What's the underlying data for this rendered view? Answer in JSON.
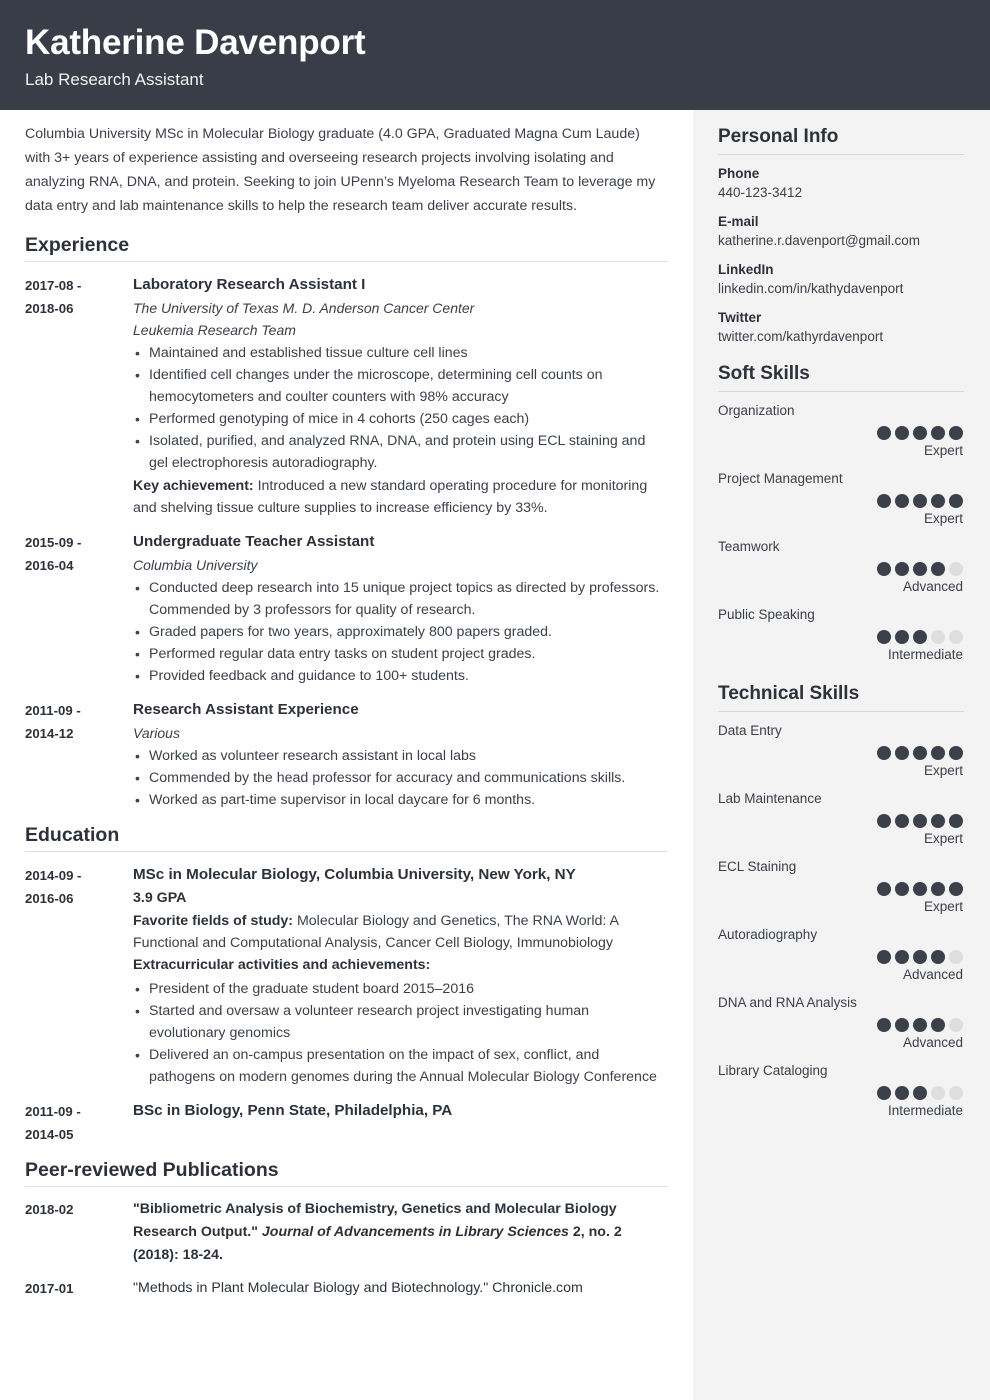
{
  "header": {
    "name": "Katherine Davenport",
    "role": "Lab Research Assistant",
    "bg_color": "#383d47"
  },
  "summary": "Columbia University MSc in Molecular Biology graduate (4.0 GPA, Graduated Magna Cum Laude) with 3+ years of experience assisting and overseeing research projects involving isolating and analyzing RNA, DNA, and protein. Seeking to join UPenn’s Myeloma Research Team to leverage my data entry and lab maintenance skills to help the research team deliver accurate results.",
  "sections": {
    "experience_title": "Experience",
    "education_title": "Education",
    "publications_title": "Peer-reviewed Publications"
  },
  "experience": [
    {
      "date": "2017-08 -\n2018-06",
      "date_start": "2017-08 -",
      "date_end": "2018-06",
      "title": "Laboratory Research Assistant I",
      "org": "The University of Texas M. D. Anderson Cancer Center",
      "team": "Leukemia Research Team",
      "bullets": [
        "Maintained and established tissue culture cell lines",
        "Identified cell changes under the microscope, determining cell counts on hemocytometers and coulter counters with 98% accuracy",
        "Performed genotyping of mice in 4 cohorts (250 cages each)",
        "Isolated, purified, and analyzed RNA, DNA, and protein using ECL staining and gel electrophoresis autoradiography."
      ],
      "key_achievement_label": "Key achievement:",
      "key_achievement_text": " Introduced a new standard operating procedure for monitoring and shelving tissue culture supplies to increase efficiency by 33%."
    },
    {
      "date_start": "2015-09 -",
      "date_end": "2016-04",
      "title": "Undergraduate Teacher Assistant",
      "org": "Columbia University",
      "team": "",
      "bullets": [
        "Conducted deep research into 15 unique project topics as directed by professors. Commended by 3 professors for quality of research.",
        "Graded papers for two years, approximately 800 papers graded.",
        "Performed regular data entry tasks on student project grades.",
        "Provided feedback and guidance to 100+ students."
      ]
    },
    {
      "date_start": "2011-09 -",
      "date_end": "2014-12",
      "title": "Research Assistant Experience",
      "org": "Various",
      "team": "",
      "bullets": [
        "Worked as volunteer research assistant in local labs",
        "Commended by the head professor for accuracy and communications skills.",
        "Worked as part-time supervisor in local daycare for 6 months."
      ]
    }
  ],
  "education": [
    {
      "date_start": "2014-09 -",
      "date_end": "2016-06",
      "title": "MSc in Molecular Biology, Columbia University, New York, NY",
      "gpa": "3.9 GPA",
      "fields_label": "Favorite fields of study:",
      "fields_text": " Molecular Biology and Genetics, The RNA World: A Functional and Computational Analysis, Cancer Cell Biology, Immunobiology",
      "extra_label": "Extracurricular activities and achievements:",
      "bullets": [
        "President of the graduate student board 2015–2016",
        "Started and oversaw a volunteer research project investigating human evolutionary genomics",
        "Delivered an on-campus presentation on the impact of sex, conflict, and pathogens on modern genomes during the Annual Molecular Biology Conference"
      ]
    },
    {
      "date_start": "2011-09 -",
      "date_end": "2014-05",
      "title": "BSc in Biology, Penn State, Philadelphia, PA",
      "gpa": "",
      "fields_label": "",
      "fields_text": "",
      "extra_label": "",
      "bullets": []
    }
  ],
  "publications": [
    {
      "date": "2018-02",
      "part1": "\"Bibliometric Analysis of Biochemistry, Genetics and Molecular Biology Research Output.\" ",
      "journal": "Journal of Advancements in Library Sciences",
      "part2": " 2, no. 2 (2018): 18-24.",
      "bold": true
    },
    {
      "date": "2017-01",
      "part1": "\"Methods in Plant Molecular Biology and Biotechnology.\" Chronicle.com",
      "journal": "",
      "part2": "",
      "bold": false
    }
  ],
  "sidebar": {
    "bg_color": "#f3f3f3",
    "personal_info": {
      "title": "Personal Info",
      "items": [
        {
          "label": "Phone",
          "value": "440-123-3412"
        },
        {
          "label": "E-mail",
          "value": "katherine.r.davenport@gmail.com"
        },
        {
          "label": "LinkedIn",
          "value": "linkedin.com/in/kathydavenport"
        },
        {
          "label": "Twitter",
          "value": "twitter.com/kathyrdavenport"
        }
      ]
    },
    "soft_skills": {
      "title": "Soft Skills",
      "max_dots": 5,
      "items": [
        {
          "name": "Organization",
          "filled": 5,
          "level": "Expert"
        },
        {
          "name": "Project Management",
          "filled": 5,
          "level": "Expert"
        },
        {
          "name": "Teamwork",
          "filled": 4,
          "level": "Advanced"
        },
        {
          "name": "Public Speaking",
          "filled": 3,
          "level": "Intermediate"
        }
      ]
    },
    "technical_skills": {
      "title": "Technical Skills",
      "max_dots": 5,
      "items": [
        {
          "name": "Data Entry",
          "filled": 5,
          "level": "Expert"
        },
        {
          "name": "Lab Maintenance",
          "filled": 5,
          "level": "Expert"
        },
        {
          "name": "ECL Staining",
          "filled": 5,
          "level": "Expert"
        },
        {
          "name": "Autoradiography",
          "filled": 4,
          "level": "Advanced"
        },
        {
          "name": "DNA and RNA Analysis",
          "filled": 4,
          "level": "Advanced"
        },
        {
          "name": "Library Cataloging",
          "filled": 3,
          "level": "Intermediate"
        }
      ]
    }
  }
}
